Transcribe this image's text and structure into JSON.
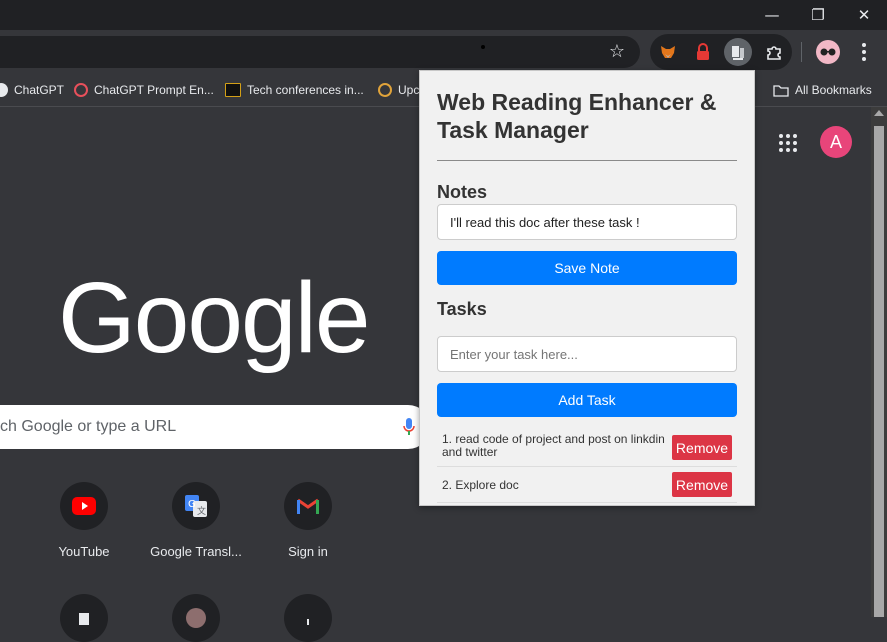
{
  "window": {
    "minimize_glyph": "—",
    "restore_glyph": "❐",
    "close_glyph": "✕"
  },
  "toolbar": {
    "star_glyph": "☆",
    "extensions": [
      {
        "name": "metamask",
        "icon": "fox-icon",
        "color": "#e2761b"
      },
      {
        "name": "password-manager",
        "icon": "lock-icon",
        "color": "#e53935"
      },
      {
        "name": "reading-enhancer",
        "icon": "reader-icon",
        "color": "#e8eaed"
      },
      {
        "name": "extensions",
        "icon": "puzzle-icon",
        "color": "#e8eaed"
      }
    ],
    "profile_icon": "glasses-icon"
  },
  "bookmarks": {
    "items": [
      {
        "label": "ChatGPT",
        "icon": "openai-icon",
        "color": "#e8eaed"
      },
      {
        "label": "ChatGPT Prompt En...",
        "icon": "prompt-icon",
        "color": "#e8505b"
      },
      {
        "label": "Tech conferences in...",
        "icon": "conference-icon",
        "color": "#111111"
      },
      {
        "label": "Upc",
        "icon": "upcoming-icon",
        "color": "#e0a33a"
      }
    ],
    "all_bookmarks": "All Bookmarks"
  },
  "ntp": {
    "logo": "Google",
    "search_placeholder": "ch Google or type a URL",
    "avatar_letter": "A",
    "avatar_color": "#e8457a",
    "shortcuts": [
      {
        "label": "YouTube",
        "icon": "youtube-icon"
      },
      {
        "label": "Google Transl...",
        "icon": "translate-icon"
      },
      {
        "label": "Sign in",
        "icon": "gmail-icon"
      }
    ]
  },
  "popup": {
    "title": "Web Reading Enhancer & Task Manager",
    "notes_heading": "Notes",
    "note_value": "I'll read this doc after these task !",
    "save_note_label": "Save Note",
    "tasks_heading": "Tasks",
    "task_placeholder": "Enter your task here...",
    "add_task_label": "Add Task",
    "tasks": [
      {
        "text": "1. read code of project and post on linkdin and twitter",
        "remove_label": "Remove"
      },
      {
        "text": "2. Explore doc",
        "remove_label": "Remove"
      }
    ],
    "accent_color": "#007bff",
    "remove_color": "#dc3545"
  }
}
